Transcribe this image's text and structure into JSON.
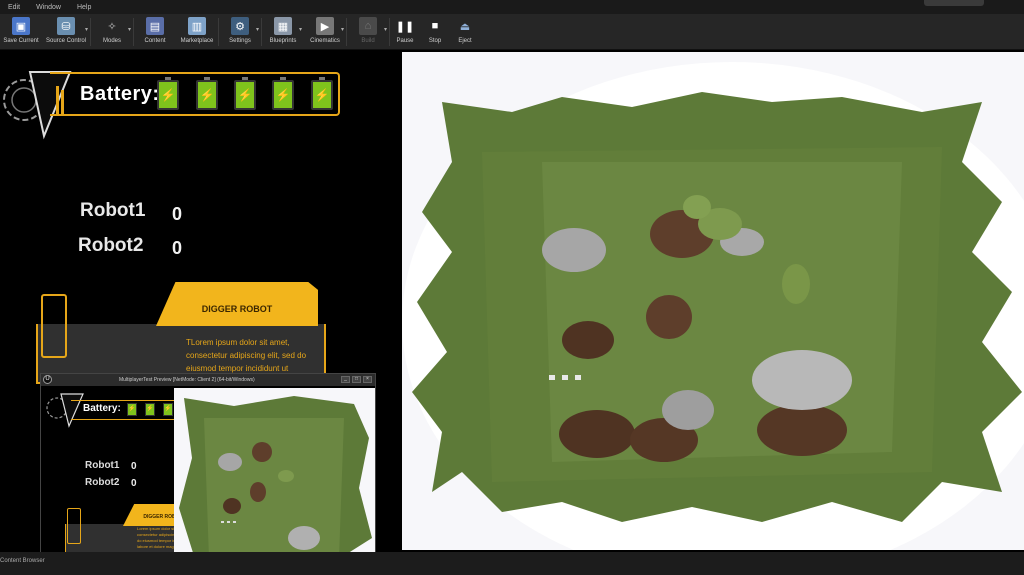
{
  "menu": [
    "Edit",
    "Window",
    "Help"
  ],
  "toolbar": [
    {
      "label": "Save Current",
      "icon": "save-icon",
      "color": "#4a76c9"
    },
    {
      "label": "Source Control",
      "icon": "source-control-icon",
      "color": "#6a8fb0",
      "dropdown": true
    },
    {
      "label": "Modes",
      "icon": "modes-icon",
      "color": "#c0c0c0",
      "dropdown": true
    },
    {
      "label": "Content",
      "icon": "content-icon",
      "color": "#5a6ea8"
    },
    {
      "label": "Marketplace",
      "icon": "marketplace-icon",
      "color": "#7ea2c8"
    },
    {
      "label": "Settings",
      "icon": "settings-icon",
      "color": "#6aa0d0",
      "dropdown": true
    },
    {
      "label": "Blueprints",
      "icon": "blueprints-icon",
      "color": "#9aa8b8",
      "dropdown": true
    },
    {
      "label": "Cinematics",
      "icon": "cinematics-icon",
      "color": "#c8c8c8",
      "dropdown": true
    },
    {
      "label": "Build",
      "icon": "build-icon",
      "color": "#555555",
      "dropdown": true
    },
    {
      "label": "Pause",
      "icon": "pause-icon",
      "color": "#dddddd"
    },
    {
      "label": "Stop",
      "icon": "stop-icon",
      "color": "#dddddd"
    },
    {
      "label": "Eject",
      "icon": "eject-icon",
      "color": "#8fb0d8"
    }
  ],
  "hud": {
    "battery_label": "Battery:",
    "cell_glyph": "⚡",
    "robots": [
      {
        "name": "Robot1",
        "value": "0"
      },
      {
        "name": "Robot2",
        "value": "0"
      }
    ],
    "digger_title": "DIGGER ROBOT",
    "digger_text": "TLorem ipsum dolor sit amet, consectetur adipiscing elit, sed do eiusmod tempor incididunt ut"
  },
  "preview": {
    "title": "MultiplayerTest Preview [NetMode: Client 2] (64-bit/Windows)",
    "battery_label": "Battery:",
    "robots": [
      {
        "name": "Robot1",
        "value": "0"
      },
      {
        "name": "Robot2",
        "value": "0"
      }
    ],
    "digger_title": "DIGGER ROBOT",
    "digger_text": "Lorem ipsum dolor sit amet, consectetur adipiscing elit, sed do eiusmod tempor incididunt ut labore et dolore magna aliqua"
  },
  "status": {
    "text": "Content Browser"
  },
  "colors": {
    "accent": "#e6a619",
    "battery_green": "#7fc31c",
    "grass": "#5f7a3a"
  }
}
